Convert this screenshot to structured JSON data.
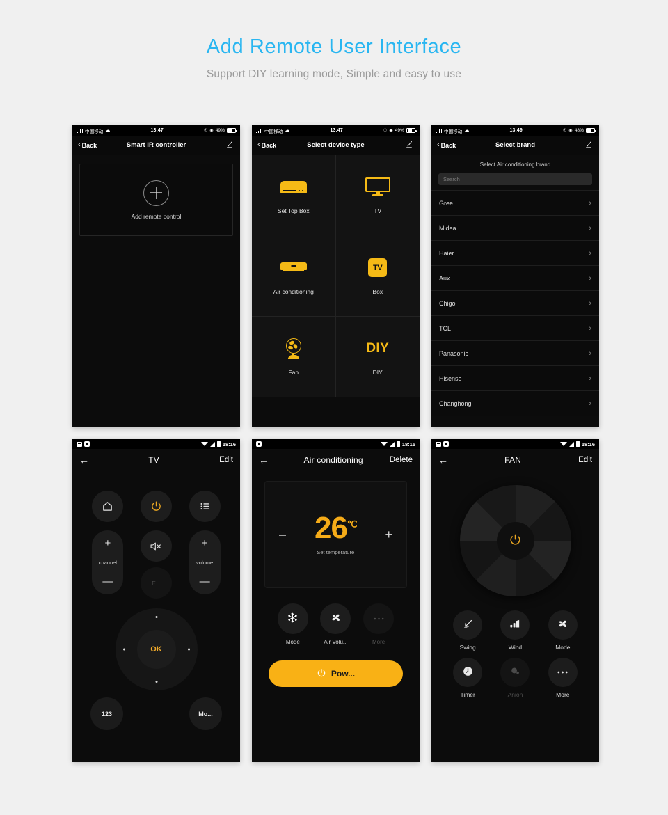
{
  "header": {
    "title": "Add Remote  User Interface",
    "subtitle": "Support DIY learning mode, Simple and easy to use",
    "title_color": "#29b6f1",
    "subtitle_color": "#9a9a9a"
  },
  "theme": {
    "page_bg": "#f0f0f0",
    "screen_bg": "#0c0c0c",
    "accent": "#f5ba16",
    "accent_button": "#f9b115"
  },
  "screens": [
    {
      "id": "smart-ir-controller",
      "platform": "ios",
      "status": {
        "carrier": "中国移动",
        "wifi": "wifi-icon",
        "time": "13:47",
        "battery_percent": "49%",
        "alarm": "alarm-icon",
        "lock": "lock-icon"
      },
      "nav": {
        "back": "Back",
        "title": "Smart IR controller",
        "edit": "edit-pencil-icon"
      },
      "add_card": {
        "icon": "plus-circle-icon",
        "label": "Add remote control"
      }
    },
    {
      "id": "select-device-type",
      "platform": "ios",
      "status": {
        "carrier": "中国移动",
        "wifi": "wifi-icon",
        "time": "13:47",
        "battery_percent": "49%",
        "alarm": "alarm-icon",
        "lock": "lock-icon"
      },
      "nav": {
        "back": "Back",
        "title": "Select device type",
        "edit": "edit-pencil-icon"
      },
      "devices": [
        {
          "label": "Set Top Box",
          "icon": "set-top-box-icon"
        },
        {
          "label": "TV",
          "icon": "tv-icon"
        },
        {
          "label": "Air conditioning",
          "icon": "air-conditioner-icon"
        },
        {
          "label": "Box",
          "icon": "tv-box-icon",
          "icon_text": "TV"
        },
        {
          "label": "Fan",
          "icon": "fan-icon"
        },
        {
          "label": "DIY",
          "icon": "diy-icon",
          "icon_text": "DIY"
        }
      ]
    },
    {
      "id": "select-brand",
      "platform": "ios",
      "status": {
        "carrier": "中国移动",
        "wifi": "wifi-icon",
        "time": "13:49",
        "battery_percent": "48%",
        "alarm": "alarm-icon",
        "lock": "lock-icon"
      },
      "nav": {
        "back": "Back",
        "title": "Select brand",
        "edit": "edit-pencil-icon"
      },
      "subtitle": "Select  Air conditioning  brand",
      "search_placeholder": "Search",
      "brands": [
        "Gree",
        "Midea",
        "Haier",
        "Aux",
        "Chigo",
        "TCL",
        "Panasonic",
        "Hisense",
        "Changhong"
      ]
    },
    {
      "id": "tv-remote",
      "platform": "android",
      "status": {
        "time": "18:16",
        "icons": [
          "sim-icon",
          "shield-icon",
          "wifi-icon",
          "signal-icon",
          "battery-icon"
        ]
      },
      "nav": {
        "back": "back-arrow-icon",
        "title": "TV",
        "dot": "·",
        "action": "Edit"
      },
      "top_buttons": [
        {
          "name": "home",
          "icon": "home-icon"
        },
        {
          "name": "power",
          "icon": "power-icon"
        },
        {
          "name": "menu",
          "icon": "list-menu-icon"
        }
      ],
      "channel_pill": {
        "plus": "+",
        "label": "channel",
        "minus": "—"
      },
      "volume_pill": {
        "plus": "+",
        "label": "volume",
        "minus": "—"
      },
      "mute_button": {
        "icon": "mute-icon"
      },
      "extra_button": {
        "label": "E..."
      },
      "dpad": {
        "ok": "OK"
      },
      "bottom_buttons": [
        {
          "label": "123"
        },
        {
          "label": "Mo..."
        }
      ]
    },
    {
      "id": "air-conditioning-remote",
      "platform": "android",
      "status": {
        "time": "18:15",
        "icons": [
          "shield-icon",
          "wifi-icon",
          "signal-icon",
          "battery-icon"
        ]
      },
      "nav": {
        "back": "back-arrow-icon",
        "title": "Air conditioning",
        "dot": "·",
        "action": "Delete"
      },
      "temperature": {
        "minus": "–",
        "value": "26",
        "unit": "℃",
        "label": "Set temperature",
        "plus": "+"
      },
      "actions": [
        {
          "label": "Mode",
          "icon": "snowflake-icon",
          "enabled": true
        },
        {
          "label": "Air Volu...",
          "icon": "fan-blade-icon",
          "enabled": true
        },
        {
          "label": "More",
          "icon": "more-dots-icon",
          "enabled": false
        }
      ],
      "power_button": {
        "label": "Pow...",
        "icon": "power-icon"
      }
    },
    {
      "id": "fan-remote",
      "platform": "android",
      "status": {
        "time": "18:16",
        "icons": [
          "sim-icon",
          "shield-icon",
          "wifi-icon",
          "signal-icon",
          "battery-icon"
        ]
      },
      "nav": {
        "back": "back-arrow-icon",
        "title": "FAN",
        "dot": "·",
        "action": "Edit"
      },
      "wheel": {
        "center_icon": "power-icon"
      },
      "actions": [
        {
          "label": "Swing",
          "icon": "swing-icon",
          "enabled": true
        },
        {
          "label": "Wind",
          "icon": "wind-bars-icon",
          "enabled": true
        },
        {
          "label": "Mode",
          "icon": "fan-blade-icon",
          "enabled": true
        },
        {
          "label": "Timer",
          "icon": "clock-icon",
          "enabled": true
        },
        {
          "label": "Anion",
          "icon": "anion-icon",
          "enabled": false
        },
        {
          "label": "More",
          "icon": "more-dots-icon",
          "enabled": true
        }
      ]
    }
  ]
}
